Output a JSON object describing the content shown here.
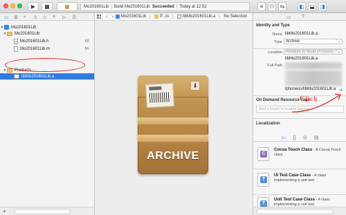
{
  "toolbar": {
    "activity": {
      "scheme": "Mo201601Lib",
      "status_prefix": "Build Mo201601Lib:",
      "status": "Succeeded",
      "time": "Today at 12:52"
    }
  },
  "navigator": {
    "items": [
      {
        "label": "Mo201601Lib",
        "badge": ""
      },
      {
        "label": "Mo201601Lib",
        "badge": ""
      },
      {
        "label": "Mo201601Lib.h",
        "badge": "M"
      },
      {
        "label": "Mo201601Lib.m",
        "badge": "M"
      },
      {
        "label": "Products",
        "badge": ""
      },
      {
        "label": "libMo201601Lib.a",
        "badge": ""
      }
    ]
  },
  "editor": {
    "jumpbar": {
      "crumb1": "Mo201601Lib",
      "crumb2": "P...ts",
      "crumb3": "libMo201601Lib.a",
      "crumb4": "No Selection"
    },
    "archive_word": "ARCHIVE"
  },
  "inspector": {
    "identity_title": "Identity and Type",
    "name_label": "Name",
    "name_value": "libMo201601Lib.a",
    "type_label": "Type",
    "type_value": "Archive",
    "location_label": "Location",
    "location_value": "Relative to Build Products",
    "location_file": "libMo201601Lib.a",
    "full_path_label": "Full Path",
    "full_path_value": "lphoneos/libMo201601Lib.a",
    "odr_title": "On Demand Resource Tags",
    "tag_placeholder": "Add a target to enable tagging",
    "localization_title": "Localization",
    "templates": [
      {
        "name": "Cocoa Touch Class",
        "desc": " - A Cocoa Touch class",
        "glyph": "C",
        "color": "#8e6bbf"
      },
      {
        "name": "UI Test Case Class",
        "desc": " - A class implementing a unit test",
        "glyph": "T",
        "color": "#5a8fd0"
      },
      {
        "name": "Unit Test Case Class",
        "desc": " - A class implementing a unit test",
        "glyph": "T",
        "color": "#5a8fd0"
      }
    ]
  },
  "annotation": {
    "click_text": "Click"
  }
}
